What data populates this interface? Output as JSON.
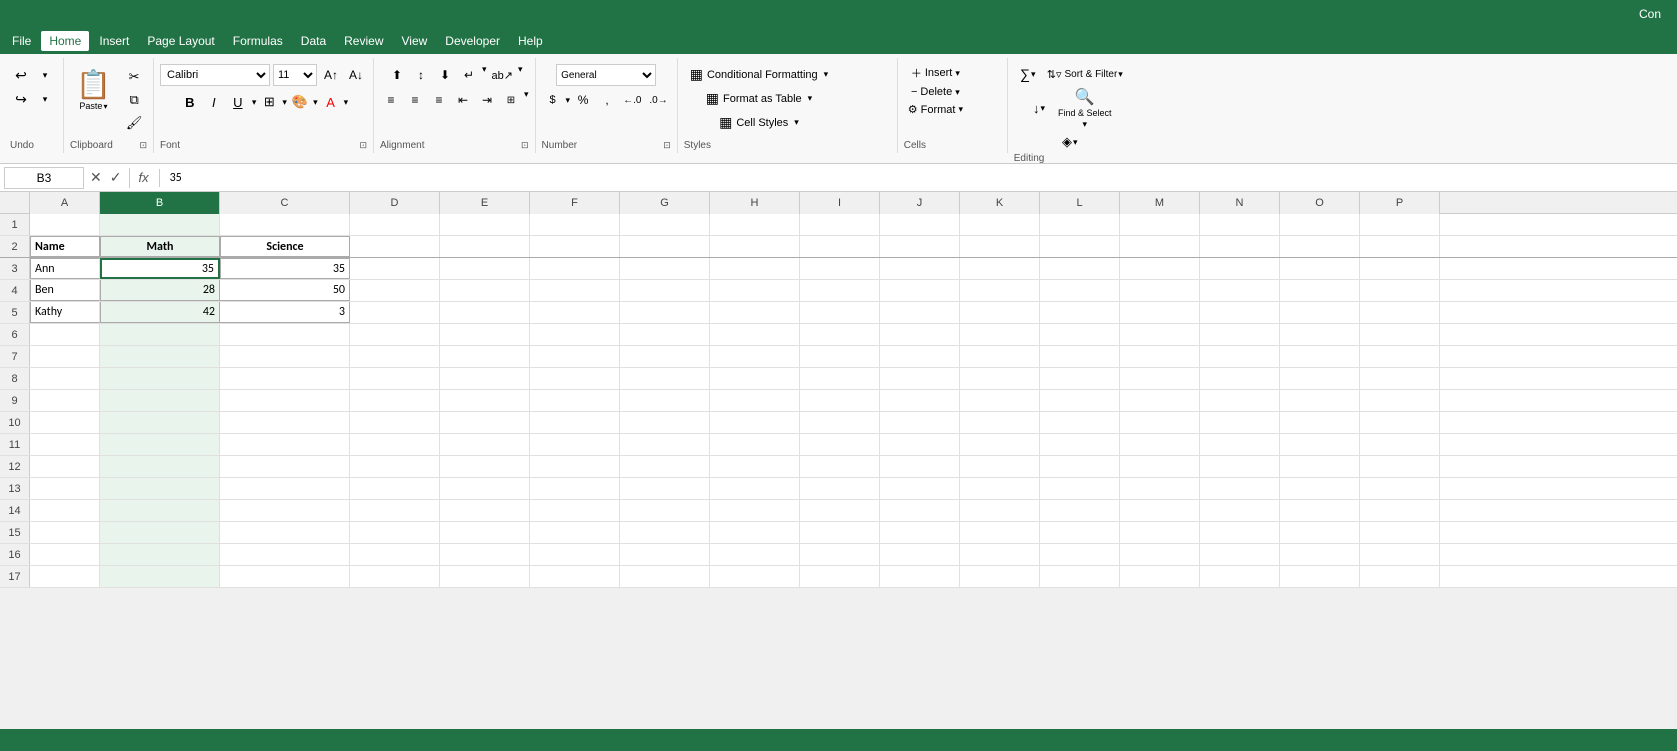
{
  "titlebar": {
    "con_label": "Con"
  },
  "menubar": {
    "items": [
      {
        "id": "file",
        "label": "File"
      },
      {
        "id": "home",
        "label": "Home",
        "active": true
      },
      {
        "id": "insert",
        "label": "Insert"
      },
      {
        "id": "page-layout",
        "label": "Page Layout"
      },
      {
        "id": "formulas",
        "label": "Formulas"
      },
      {
        "id": "data",
        "label": "Data"
      },
      {
        "id": "review",
        "label": "Review"
      },
      {
        "id": "view",
        "label": "View"
      },
      {
        "id": "developer",
        "label": "Developer"
      },
      {
        "id": "help",
        "label": "Help"
      }
    ]
  },
  "ribbon": {
    "groups": {
      "undo": {
        "label": "Undo",
        "undo_btn": "↩",
        "redo_btn": "↪"
      },
      "clipboard": {
        "label": "Clipboard",
        "paste_label": "Paste",
        "cut_icon": "✂",
        "copy_icon": "⧉",
        "format_painter_icon": "🖌"
      },
      "font": {
        "label": "Font",
        "font_name": "Calibri",
        "font_size": "11",
        "bold": "B",
        "italic": "I",
        "underline": "U",
        "increase_font": "A↑",
        "decrease_font": "A↓"
      },
      "alignment": {
        "label": "Alignment"
      },
      "number": {
        "label": "Number",
        "format": "General"
      },
      "styles": {
        "label": "Styles",
        "conditional_formatting": "Conditional Formatting",
        "format_as_table": "Format as Table",
        "cell_styles": "Cell Styles"
      },
      "cells": {
        "label": "Cells",
        "insert": "Insert",
        "delete": "Delete",
        "format": "Format"
      },
      "editing": {
        "label": "Editing",
        "autosum": "∑",
        "fill": "↓",
        "clear": "◈",
        "sort_filter": "Sort & Filter",
        "find_select": "Find & Select"
      }
    }
  },
  "formula_bar": {
    "cell_ref": "B3",
    "formula_value": "35",
    "fx_label": "fx"
  },
  "spreadsheet": {
    "columns": [
      "A",
      "B",
      "C",
      "D",
      "E",
      "F",
      "G",
      "H",
      "I",
      "J",
      "K",
      "L",
      "M",
      "N",
      "O",
      "P"
    ],
    "active_cell": "B3",
    "active_col": "B",
    "rows": [
      {
        "num": "1",
        "cells": [
          "",
          "",
          "",
          "",
          "",
          "",
          "",
          "",
          "",
          "",
          "",
          "",
          "",
          "",
          "",
          ""
        ]
      },
      {
        "num": "2",
        "cells": [
          "Name",
          "Math",
          "Science",
          "",
          "",
          "",
          "",
          "",
          "",
          "",
          "",
          "",
          "",
          "",
          "",
          ""
        ]
      },
      {
        "num": "3",
        "cells": [
          "Ann",
          "35",
          "35",
          "",
          "",
          "",
          "",
          "",
          "",
          "",
          "",
          "",
          "",
          "",
          "",
          ""
        ]
      },
      {
        "num": "4",
        "cells": [
          "Ben",
          "28",
          "50",
          "",
          "",
          "",
          "",
          "",
          "",
          "",
          "",
          "",
          "",
          "",
          "",
          ""
        ]
      },
      {
        "num": "5",
        "cells": [
          "Kathy",
          "42",
          "3",
          "",
          "",
          "",
          "",
          "",
          "",
          "",
          "",
          "",
          "",
          "",
          "",
          ""
        ]
      },
      {
        "num": "6",
        "cells": [
          "",
          "",
          "",
          "",
          "",
          "",
          "",
          "",
          "",
          "",
          "",
          "",
          "",
          "",
          "",
          ""
        ]
      },
      {
        "num": "7",
        "cells": [
          "",
          "",
          "",
          "",
          "",
          "",
          "",
          "",
          "",
          "",
          "",
          "",
          "",
          "",
          "",
          ""
        ]
      },
      {
        "num": "8",
        "cells": [
          "",
          "",
          "",
          "",
          "",
          "",
          "",
          "",
          "",
          "",
          "",
          "",
          "",
          "",
          "",
          ""
        ]
      },
      {
        "num": "9",
        "cells": [
          "",
          "",
          "",
          "",
          "",
          "",
          "",
          "",
          "",
          "",
          "",
          "",
          "",
          "",
          "",
          ""
        ]
      },
      {
        "num": "10",
        "cells": [
          "",
          "",
          "",
          "",
          "",
          "",
          "",
          "",
          "",
          "",
          "",
          "",
          "",
          "",
          "",
          ""
        ]
      },
      {
        "num": "11",
        "cells": [
          "",
          "",
          "",
          "",
          "",
          "",
          "",
          "",
          "",
          "",
          "",
          "",
          "",
          "",
          "",
          ""
        ]
      },
      {
        "num": "12",
        "cells": [
          "",
          "",
          "",
          "",
          "",
          "",
          "",
          "",
          "",
          "",
          "",
          "",
          "",
          "",
          "",
          ""
        ]
      },
      {
        "num": "13",
        "cells": [
          "",
          "",
          "",
          "",
          "",
          "",
          "",
          "",
          "",
          "",
          "",
          "",
          "",
          "",
          "",
          ""
        ]
      },
      {
        "num": "14",
        "cells": [
          "",
          "",
          "",
          "",
          "",
          "",
          "",
          "",
          "",
          "",
          "",
          "",
          "",
          "",
          "",
          ""
        ]
      },
      {
        "num": "15",
        "cells": [
          "",
          "",
          "",
          "",
          "",
          "",
          "",
          "",
          "",
          "",
          "",
          "",
          "",
          "",
          "",
          ""
        ]
      },
      {
        "num": "16",
        "cells": [
          "",
          "",
          "",
          "",
          "",
          "",
          "",
          "",
          "",
          "",
          "",
          "",
          "",
          "",
          "",
          ""
        ]
      },
      {
        "num": "17",
        "cells": [
          "",
          "",
          "",
          "",
          "",
          "",
          "",
          "",
          "",
          "",
          "",
          "",
          "",
          "",
          "",
          ""
        ]
      }
    ]
  },
  "status_bar": {
    "text": ""
  }
}
